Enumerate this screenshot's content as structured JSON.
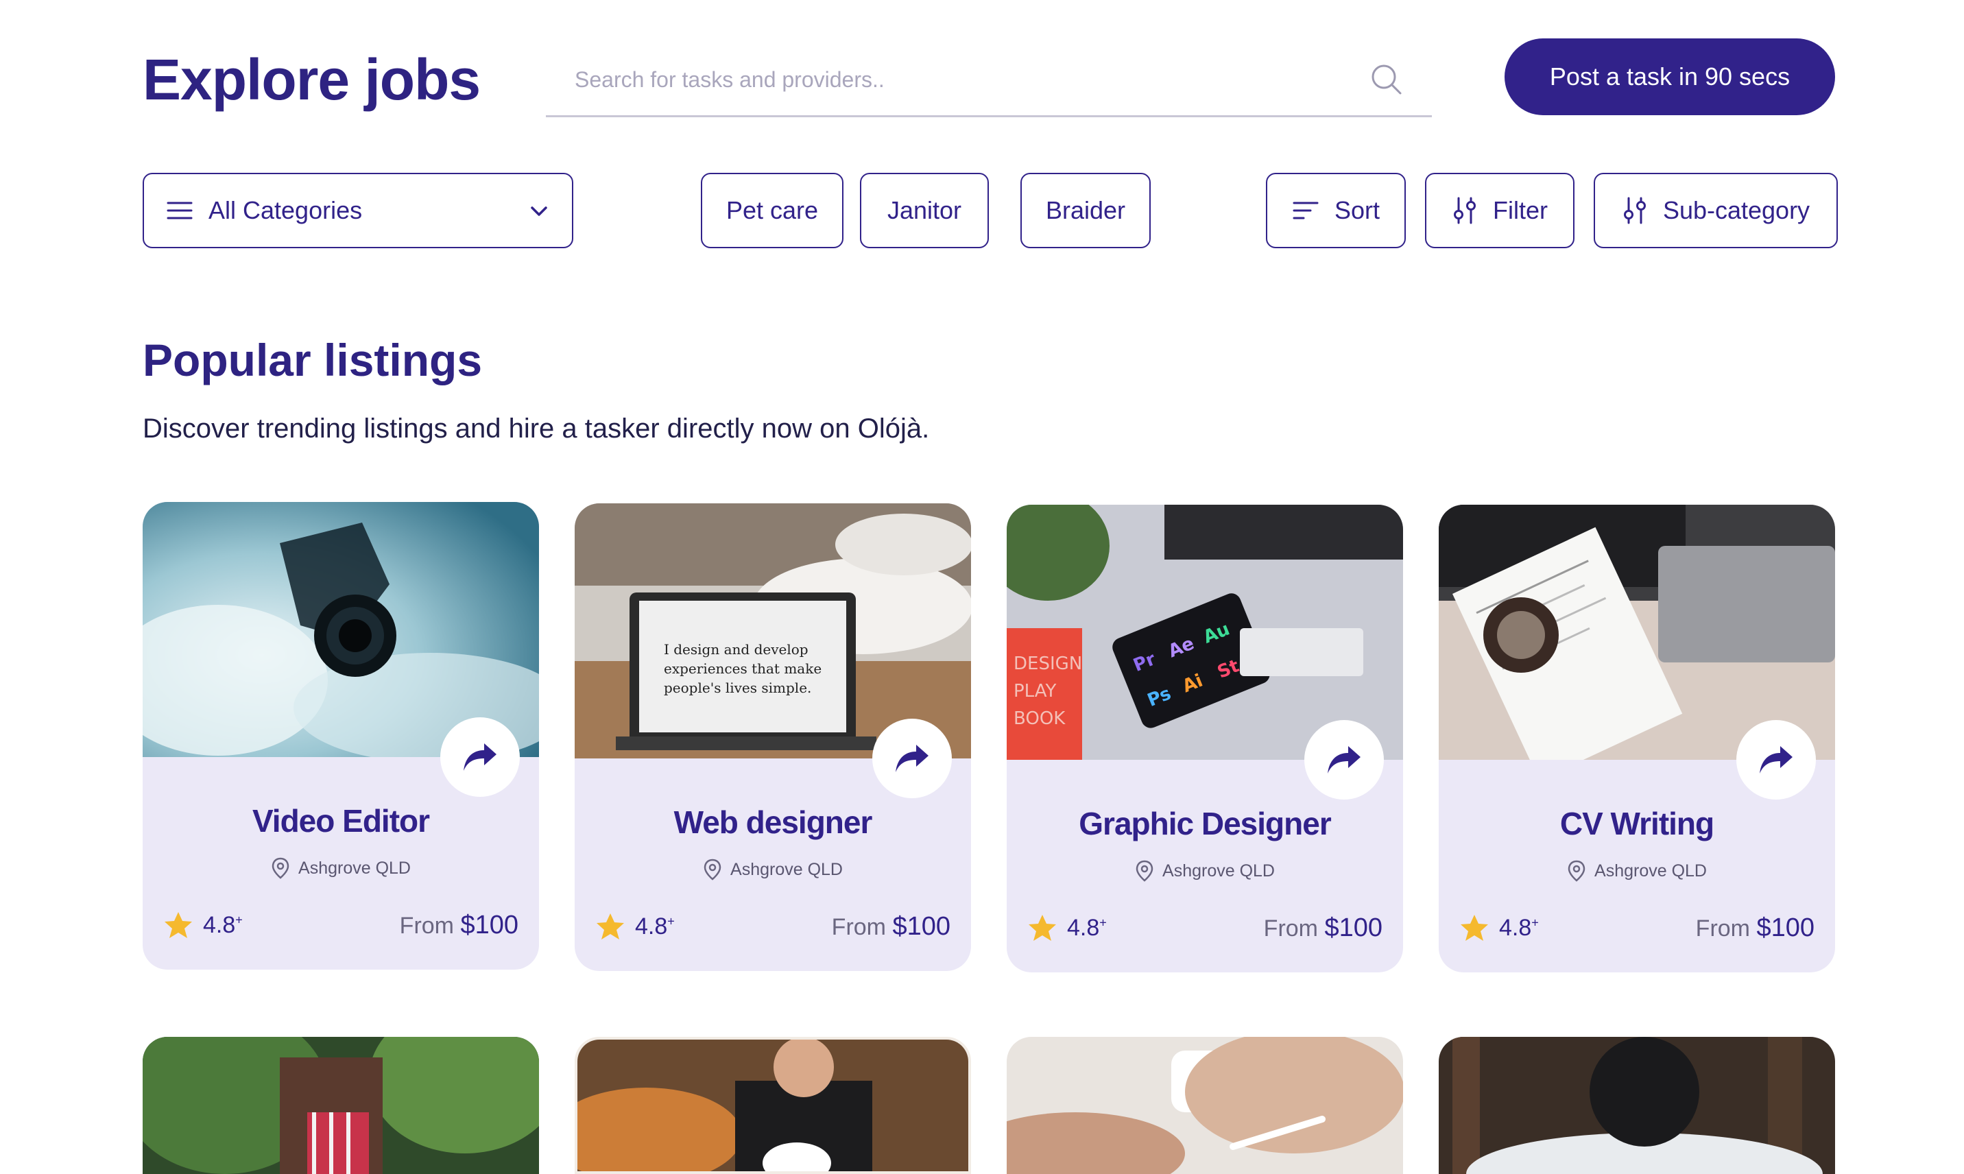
{
  "header": {
    "title": "Explore jobs",
    "search_placeholder": "Search for tasks and providers..",
    "post_button": "Post a task in 90 secs"
  },
  "filters": {
    "category_select": "All Categories",
    "chips": [
      "Pet care",
      "Janitor",
      "Braider"
    ],
    "sort": "Sort",
    "filter": "Filter",
    "subcategory": "Sub-category"
  },
  "section": {
    "title": "Popular listings",
    "subtitle": "Discover trending listings and hire a tasker directly now on Olójà."
  },
  "listings": [
    {
      "title": "Video Editor",
      "location": "Ashgrove QLD",
      "rating": "4.8",
      "rating_suffix": "+",
      "price_prefix": "From",
      "price": "$100"
    },
    {
      "title": "Web designer",
      "location": "Ashgrove QLD",
      "rating": "4.8",
      "rating_suffix": "+",
      "price_prefix": "From",
      "price": "$100"
    },
    {
      "title": "Graphic Designer",
      "location": "Ashgrove QLD",
      "rating": "4.8",
      "rating_suffix": "+",
      "price_prefix": "From",
      "price": "$100"
    },
    {
      "title": "CV Writing",
      "location": "Ashgrove QLD",
      "rating": "4.8",
      "rating_suffix": "+",
      "price_prefix": "From",
      "price": "$100"
    }
  ],
  "laptop_screen_text": "I design and develop experiences that make people's lives simple.",
  "design_icons": [
    "Pr",
    "Ae",
    "Au",
    "Ps",
    "Ai",
    "St"
  ],
  "book_text": "DESIGN PLAY BOOK",
  "colors": {
    "primary": "#31228a",
    "card_bg": "#ebe8f7",
    "star": "#f5b92e"
  }
}
